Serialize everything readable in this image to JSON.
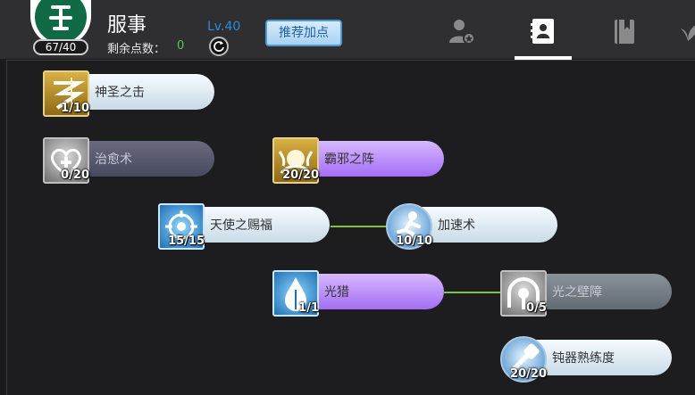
{
  "header": {
    "class_points": "67/40",
    "character_name": "服事",
    "remaining_points_label": "剩余点数：",
    "remaining_points_value": "0",
    "level": "Lv.40",
    "recommend_button": "推荐加点"
  },
  "tabs": [
    {
      "name": "character-tab",
      "active": false
    },
    {
      "name": "skills-tab",
      "active": true
    },
    {
      "name": "book-tab",
      "active": false
    },
    {
      "name": "plant-tab",
      "active": false
    }
  ],
  "skills": [
    {
      "name": "神圣之击",
      "level": "1/10"
    },
    {
      "name": "治愈术",
      "level": "0/20"
    },
    {
      "name": "霸邪之阵",
      "level": "20/20"
    },
    {
      "name": "天使之赐福",
      "level": "15/15"
    },
    {
      "name": "加速术",
      "level": "10/10"
    },
    {
      "name": "光猎",
      "level": "1/1"
    },
    {
      "name": "光之壁障",
      "level": "0/5"
    },
    {
      "name": "钝器熟练度",
      "level": "20/20"
    }
  ],
  "colors": {
    "accent_level": "#2d8ad8",
    "remaining_points": "#4ecb4e",
    "connector": "#7fc240"
  }
}
